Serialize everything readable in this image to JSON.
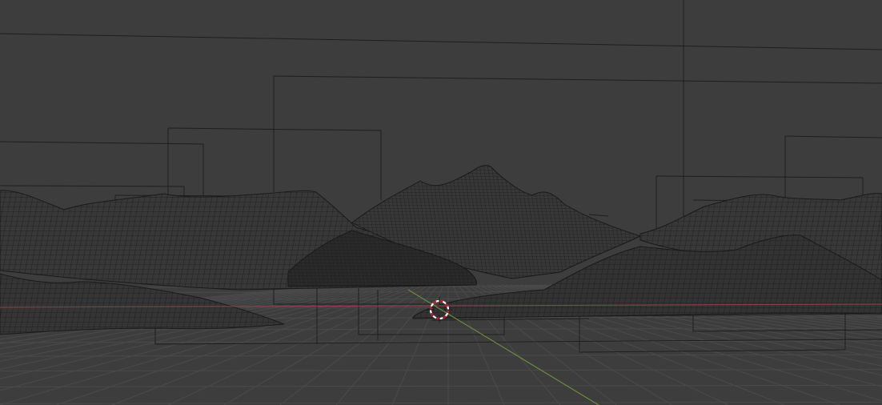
{
  "viewport": {
    "kind": "3d-viewport",
    "shading": "wireframe",
    "background_color": "#3d3d3d",
    "grid_color": "#4a4a4a",
    "x_axis_color": "#a5484f",
    "y_axis_color": "#6a8a3a",
    "wire_color": "#1a1a1a",
    "cursor_icon": "3d-cursor-icon",
    "cursor_colors": [
      "#c0142a",
      "#ffffff"
    ]
  }
}
